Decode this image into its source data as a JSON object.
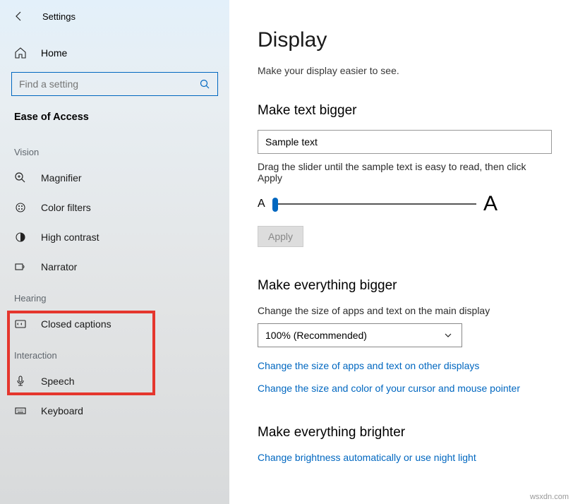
{
  "titlebar": {
    "title": "Settings"
  },
  "home": {
    "label": "Home"
  },
  "search": {
    "placeholder": "Find a setting"
  },
  "section": {
    "title": "Ease of Access"
  },
  "groups": {
    "vision": {
      "label": "Vision",
      "items": [
        {
          "icon": "magnifier-icon",
          "label": "Magnifier"
        },
        {
          "icon": "color-filters-icon",
          "label": "Color filters"
        },
        {
          "icon": "high-contrast-icon",
          "label": "High contrast"
        },
        {
          "icon": "narrator-icon",
          "label": "Narrator"
        }
      ]
    },
    "hearing": {
      "label": "Hearing",
      "items": [
        {
          "icon": "closed-captions-icon",
          "label": "Closed captions"
        }
      ]
    },
    "interaction": {
      "label": "Interaction",
      "items": [
        {
          "icon": "speech-icon",
          "label": "Speech"
        },
        {
          "icon": "keyboard-icon",
          "label": "Keyboard"
        }
      ]
    }
  },
  "main": {
    "title": "Display",
    "subtitle": "Make your display easier to see.",
    "make_text_bigger": {
      "heading": "Make text bigger",
      "sample_value": "Sample text",
      "slider_desc": "Drag the slider until the sample text is easy to read, then click Apply",
      "small_a": "A",
      "large_a": "A",
      "apply_label": "Apply"
    },
    "make_everything_bigger": {
      "heading": "Make everything bigger",
      "desc": "Change the size of apps and text on the main display",
      "dropdown_value": "100% (Recommended)",
      "link1": "Change the size of apps and text on other displays",
      "link2": "Change the size and color of your cursor and mouse pointer"
    },
    "make_everything_brighter": {
      "heading": "Make everything brighter",
      "link": "Change brightness automatically or use night light"
    }
  },
  "watermark": "wsxdn.com"
}
